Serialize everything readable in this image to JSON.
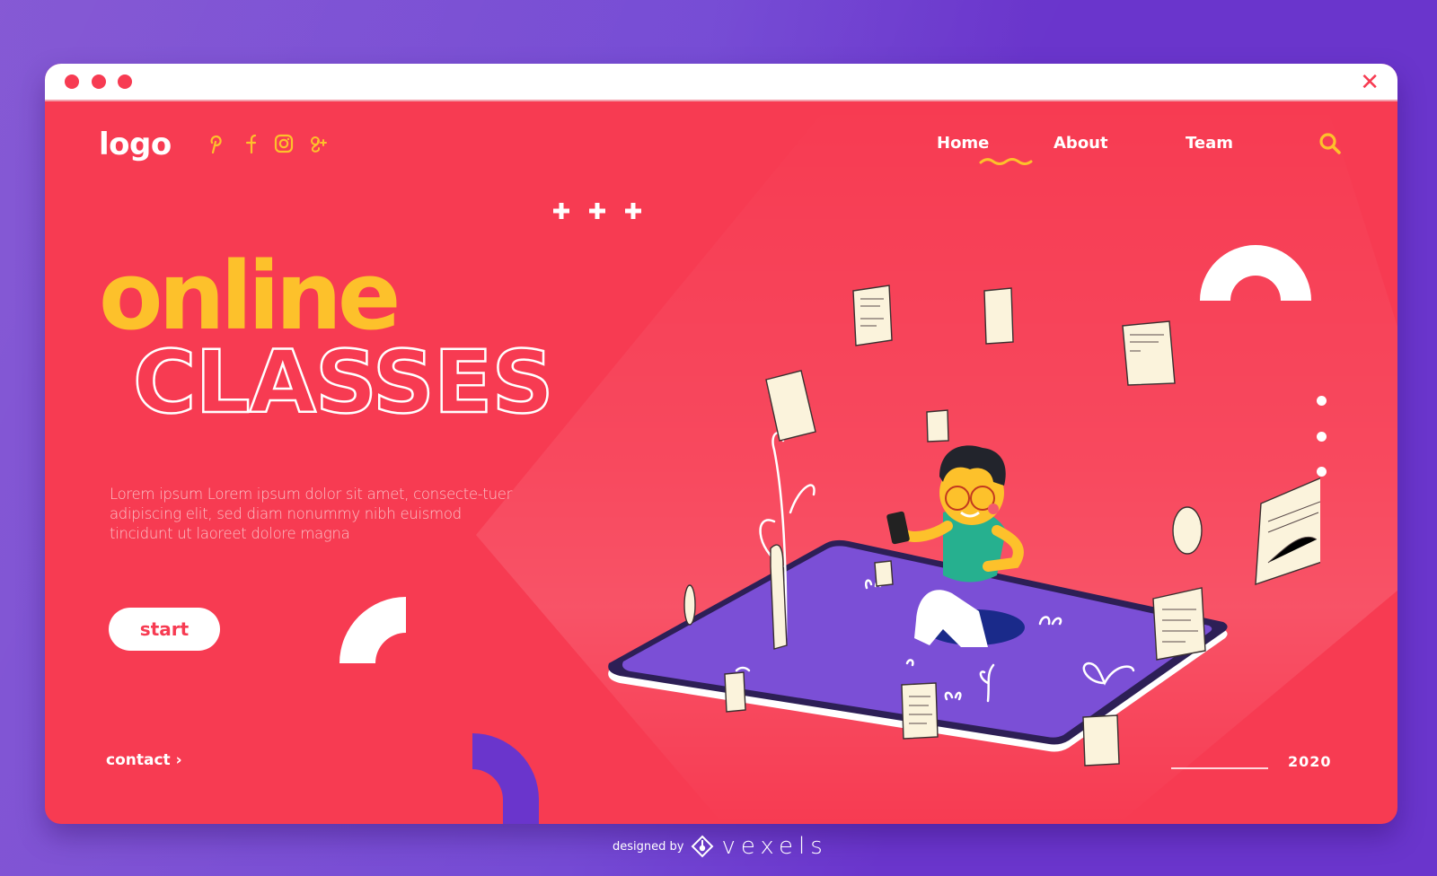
{
  "window": {
    "controls": [
      "dot",
      "dot",
      "dot"
    ],
    "close_icon": "close-icon"
  },
  "header": {
    "logo": "logo",
    "social": [
      {
        "name": "pinterest",
        "glyph": "P"
      },
      {
        "name": "facebook",
        "glyph": "f"
      },
      {
        "name": "instagram",
        "glyph": "◎"
      },
      {
        "name": "google-plus",
        "glyph": "g+"
      }
    ],
    "nav": [
      {
        "label": "Home",
        "active": true
      },
      {
        "label": "About",
        "active": false
      },
      {
        "label": "Team",
        "active": false
      }
    ],
    "search_icon": "search-icon"
  },
  "hero": {
    "decor_plus": "+",
    "title_line1": "online",
    "title_line2": "CLASSES",
    "description": "Lorem ipsum Lorem ipsum dolor sit amet, consecte-tuer adipiscing elit, sed diam nonummy nibh euismod tincidunt ut laoreet dolore magna",
    "cta": "start"
  },
  "footer": {
    "contact": "contact",
    "contact_chevron": "›",
    "year": "2020"
  },
  "pagination": {
    "dots": 3
  },
  "credit": {
    "prefix": "designed by",
    "brand": "vexels"
  },
  "colors": {
    "primary_red": "#f73b52",
    "accent_yellow": "#fdc12b",
    "background_purple": "#6a35cc",
    "tablet_purple": "#7b4fd6",
    "paper": "#fbf3dc",
    "shirt_green": "#26b08f"
  }
}
